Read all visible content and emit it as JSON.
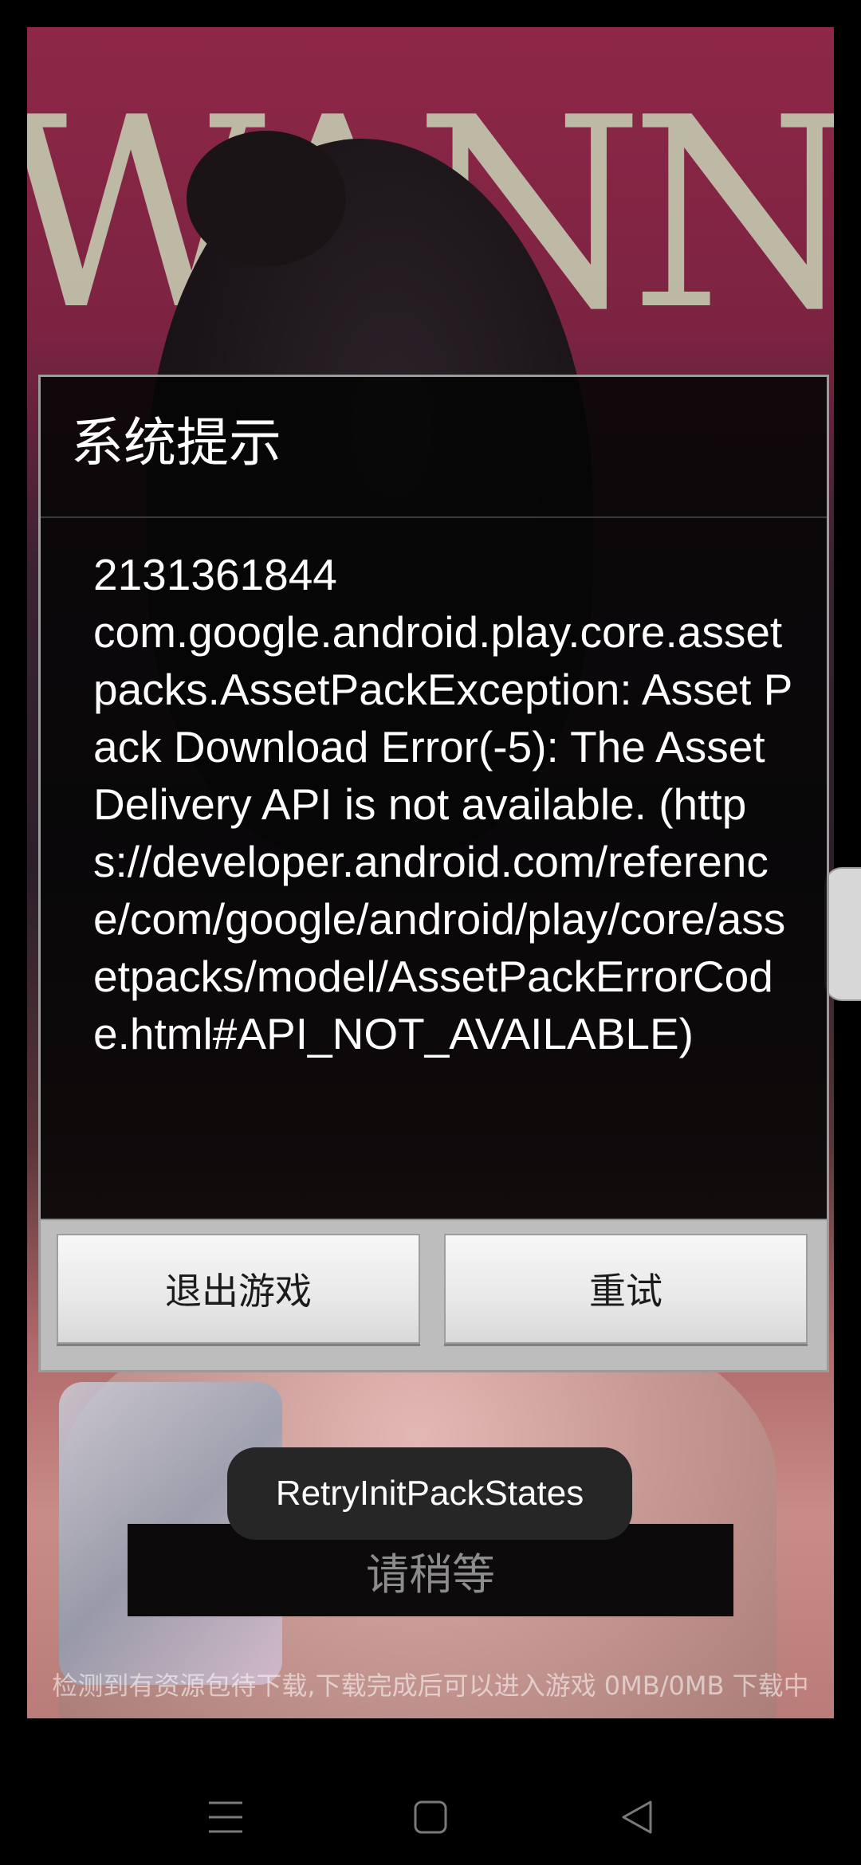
{
  "dialog": {
    "title": "系统提示",
    "message": "2131361844\ncom.google.android.play.core.assetpacks.AssetPackException: Asset Pack Download Error(-5): The Asset Delivery API is not available. (https://developer.android.com/reference/com/google/android/play/core/assetpacks/model/AssetPackErrorCode.html#API_NOT_AVAILABLE)",
    "buttons": {
      "exit": "退出游戏",
      "retry": "重试"
    }
  },
  "toast": {
    "text": "RetryInitPackStates"
  },
  "loading": {
    "wait_label": "请稍等",
    "status": "检测到有资源包待下载,下载完成后可以进入游戏 0MB/0MB 下载中"
  },
  "background": {
    "title_text": "WANNA"
  },
  "nav": {
    "icons": [
      "recents-icon",
      "home-icon",
      "back-icon"
    ]
  },
  "colors": {
    "dialog_bg": "#050505",
    "button_bar": "#bdbdbd",
    "toast_bg": "#262626",
    "accent_pink": "#8e2747"
  }
}
